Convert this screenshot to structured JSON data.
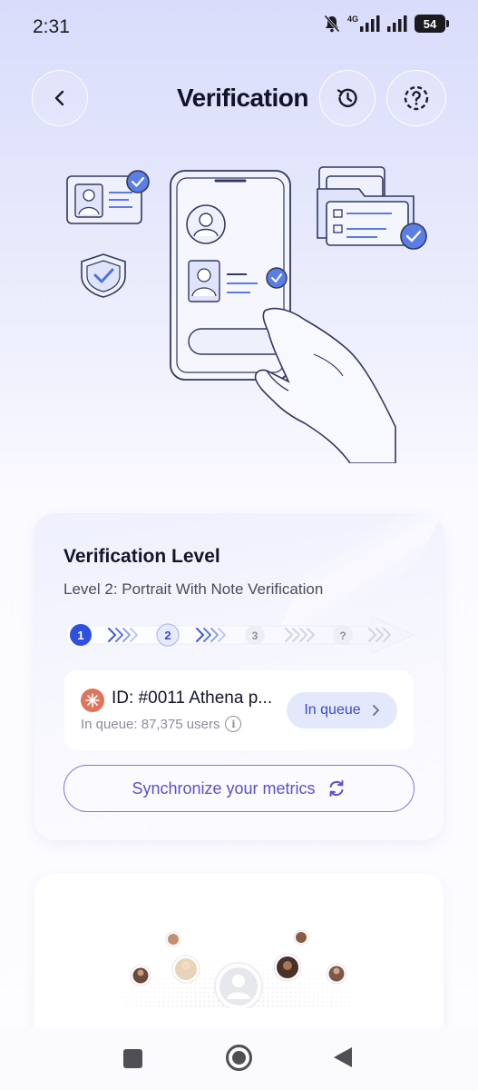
{
  "status_bar": {
    "time": "2:31",
    "network": "4G",
    "battery": "54"
  },
  "header": {
    "title": "Verification"
  },
  "verification_card": {
    "title": "Verification Level",
    "subtitle": "Level 2: Portrait With Note Verification",
    "steps": [
      {
        "label": "1",
        "state": "complete"
      },
      {
        "label": "2",
        "state": "current"
      },
      {
        "label": "3",
        "state": "pending"
      },
      {
        "label": "?",
        "state": "unknown"
      }
    ],
    "item": {
      "title": "ID: #0011 Athena p...",
      "subtitle": "In queue: 87,375 users",
      "status_button": "In queue"
    },
    "sync_button": "Synchronize your metrics"
  },
  "colors": {
    "accent": "#3b4ad0",
    "step_active": "#2f4fe0",
    "sync_text": "#5a4fcf"
  },
  "icons": [
    "back-arrow-icon",
    "history-icon",
    "help-icon",
    "info-icon",
    "chevron-right-icon",
    "refresh-icon"
  ]
}
